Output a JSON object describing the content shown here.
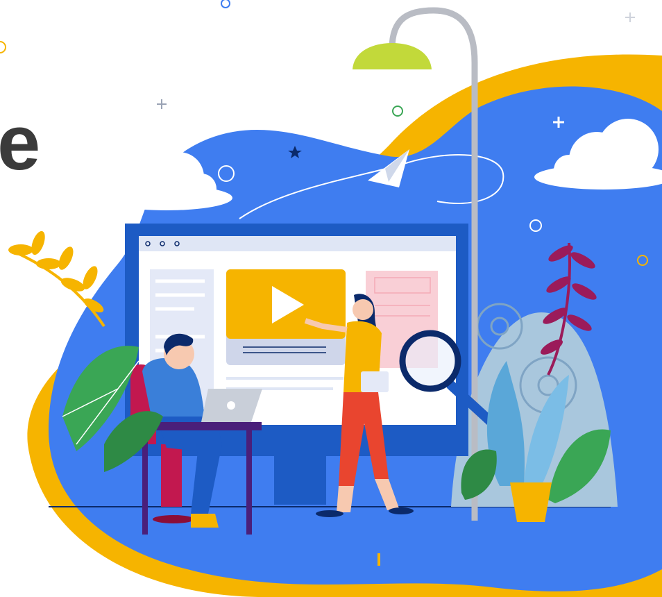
{
  "headline": {
    "text": "e"
  },
  "colors": {
    "brand_blue": "#3f7df0",
    "deep_blue": "#1d5bc4",
    "accent_yellow": "#f6b400",
    "lime": "#c2d93a",
    "ink": "#0b2a6b",
    "red_pants": "#e9452f",
    "plant_green": "#3aa655",
    "lamp_gray": "#b9bcc4"
  },
  "monitor": {
    "window_dots": "○ ○ ○",
    "play_icon": "play-icon"
  },
  "icons": [
    "plus-icon",
    "star-icon",
    "circle-icon",
    "paper-plane-icon",
    "magnifier-icon",
    "cloud-icon",
    "gear-icon",
    "leaf-icon"
  ]
}
